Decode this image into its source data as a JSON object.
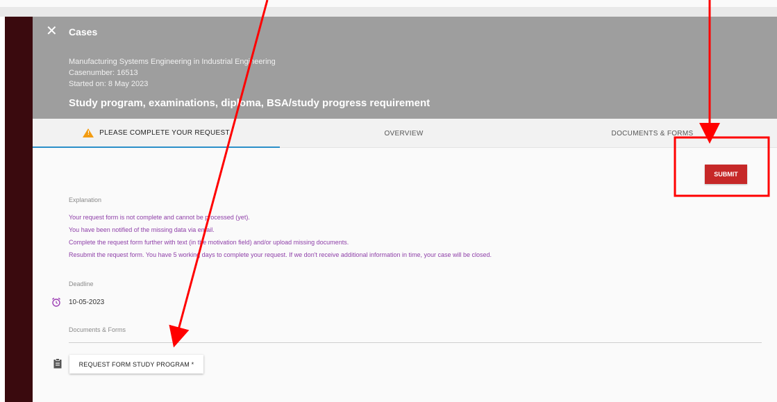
{
  "header": {
    "close_icon": "close-icon",
    "title": "Cases",
    "program": "Manufacturing Systems Engineering in Industrial Engineering",
    "casenumber": "Casenumber: 16513",
    "started": "Started on: 8 May 2023",
    "subject": "Study program, examinations, diploma, BSA/study progress requirement"
  },
  "tabs": [
    {
      "label": "PLEASE COMPLETE YOUR REQUEST",
      "icon": "warning-icon",
      "active": true
    },
    {
      "label": "OVERVIEW",
      "active": false
    },
    {
      "label": "DOCUMENTS & FORMS",
      "active": false
    }
  ],
  "actions": {
    "submit_label": "SUBMIT"
  },
  "explanation": {
    "label": "Explanation",
    "lines": [
      "Your request form is not complete and cannot be processed (yet).",
      "You have been notified of the missing data via email.",
      "Complete the request form further with text (in the motivation field) and/or upload missing documents.",
      "Resubmit the request form. You have 5 working days to complete your request. If we don't receive additional information in time, your case will be closed."
    ]
  },
  "deadline": {
    "label": "Deadline",
    "value": "10-05-2023",
    "icon": "alarm-icon"
  },
  "documents": {
    "label": "Documents & Forms",
    "icon": "clipboard-icon",
    "request_form_label": "REQUEST FORM STUDY PROGRAM *"
  },
  "colors": {
    "header_bg": "#9e9e9e",
    "submit_bg": "#c62828",
    "annotation_red": "#ff0000",
    "explanation_text": "#8e3fa8",
    "active_tab_underline": "#2a8fc8",
    "warning": "#f39c12"
  }
}
